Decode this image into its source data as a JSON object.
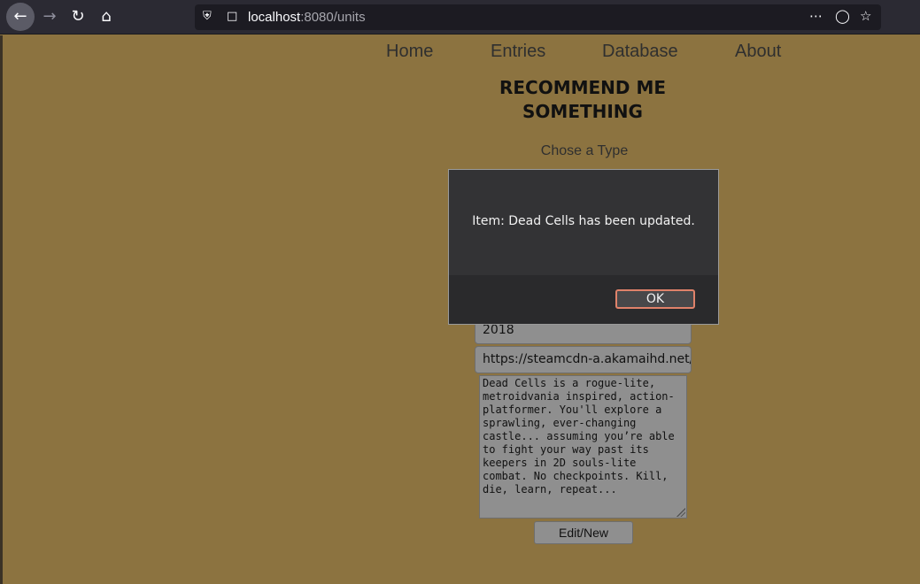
{
  "browser": {
    "url_host": "localhost",
    "url_path": ":8080/units",
    "icons": [
      "back-icon",
      "forward-icon",
      "reload-icon",
      "home-icon",
      "shield-icon",
      "page-icon",
      "more-icon",
      "pocket-icon",
      "star-icon"
    ]
  },
  "site_nav": {
    "home": "Home",
    "entries": "Entries",
    "database": "Database",
    "about": "About"
  },
  "page": {
    "title": "RECOMMEND ME SOMETHING",
    "type_label": "Chose a Type",
    "year_value": "2018",
    "image_url_value": "https://steamcdn-a.akamaihd.net/s",
    "description_value": "Dead Cells is a rogue-lite, metroidvania inspired, action-platformer. You'll explore a sprawling, ever-changing castle... assuming you’re able to fight your way past its keepers in 2D souls-lite combat. No checkpoints. Kill, die, learn, repeat...",
    "submit_label": "Edit/New"
  },
  "dialog": {
    "message": "Item: Dead Cells has been updated.",
    "ok_label": "OK"
  },
  "colors": {
    "page_bg": "#8c7340",
    "dialog_bg": "#333335",
    "focus_ring": "#e0826a"
  }
}
